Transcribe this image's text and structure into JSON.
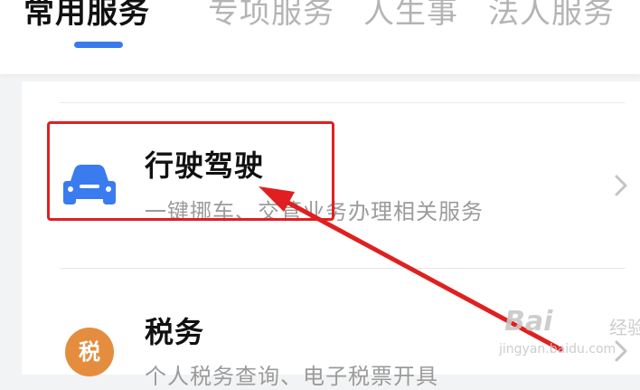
{
  "tabs": [
    {
      "label": "常用服务",
      "active": true
    },
    {
      "label": "专项服务",
      "active": false
    },
    {
      "label": "人生事",
      "active": false
    },
    {
      "label": "法人服务",
      "active": false
    }
  ],
  "services": [
    {
      "title": "行驶驾驶",
      "description": "一键挪车、交管业务办理相关服务",
      "icon": "car-icon",
      "icon_color": "#3a7bef"
    },
    {
      "title": "税务",
      "description": "个人税务查询、电子税票开具",
      "icon": "tax-icon",
      "icon_text": "税",
      "icon_color": "#e48d3f"
    }
  ],
  "annotation": {
    "color": "#e02020"
  },
  "watermark": {
    "brand": "Bai",
    "brand_cn": "经验",
    "url": "jingyan.baidu.com"
  },
  "colors": {
    "accent": "#3a7bef",
    "active_tab_text": "#111111",
    "inactive_tab_text": "#b4b4b4"
  }
}
